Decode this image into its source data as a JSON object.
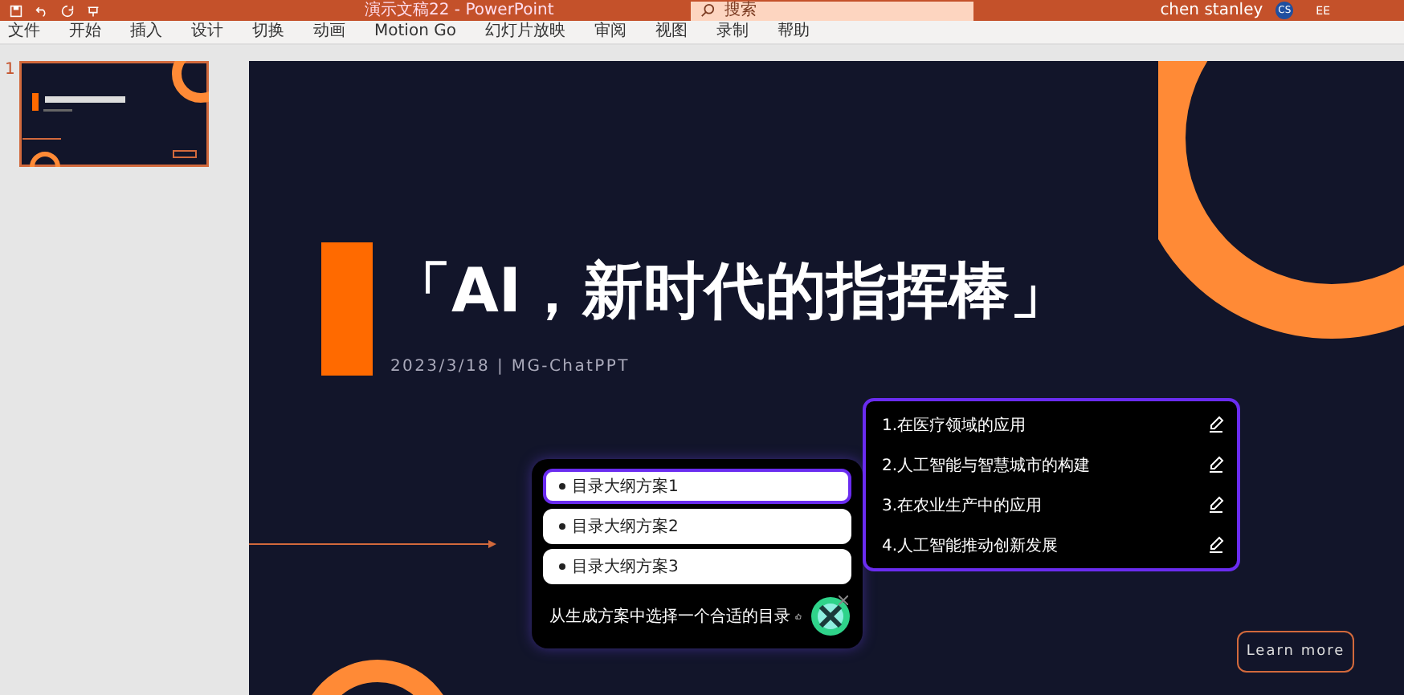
{
  "window": {
    "title": "演示文稿22 - PowerPoint",
    "search_placeholder": "搜索",
    "user": "chen stanley",
    "avatar": "CS",
    "mode": "EE"
  },
  "ribbon_tabs": [
    {
      "label": "文件",
      "selected": false
    },
    {
      "label": "开始",
      "selected": false
    },
    {
      "label": "插入",
      "selected": false
    },
    {
      "label": "设计",
      "selected": false
    },
    {
      "label": "切换",
      "selected": false
    },
    {
      "label": "动画",
      "selected": false
    },
    {
      "label": "Motion Go",
      "selected": false
    },
    {
      "label": "幻灯片放映",
      "selected": false
    },
    {
      "label": "审阅",
      "selected": false
    },
    {
      "label": "视图",
      "selected": false
    },
    {
      "label": "录制",
      "selected": false
    },
    {
      "label": "帮助",
      "selected": false
    }
  ],
  "thumbnails": [
    {
      "number": "1",
      "selected": true
    }
  ],
  "slide": {
    "title": "「AI，新时代的指挥棒」",
    "subtitle": "2023/3/18 | MG-ChatPPT",
    "button": "Learn more"
  },
  "outline_options": [
    {
      "label": "目录大纲方案1",
      "selected": true
    },
    {
      "label": "目录大纲方案2",
      "selected": false
    },
    {
      "label": "目录大纲方案3",
      "selected": false
    }
  ],
  "prompt": "从生成方案中选择一个合适的目录",
  "outline_items": [
    "1.在医疗领域的应用",
    "2.人工智能与智慧城市的构建",
    "3.在农业生产中的应用",
    "4.人工智能推动创新发展"
  ]
}
